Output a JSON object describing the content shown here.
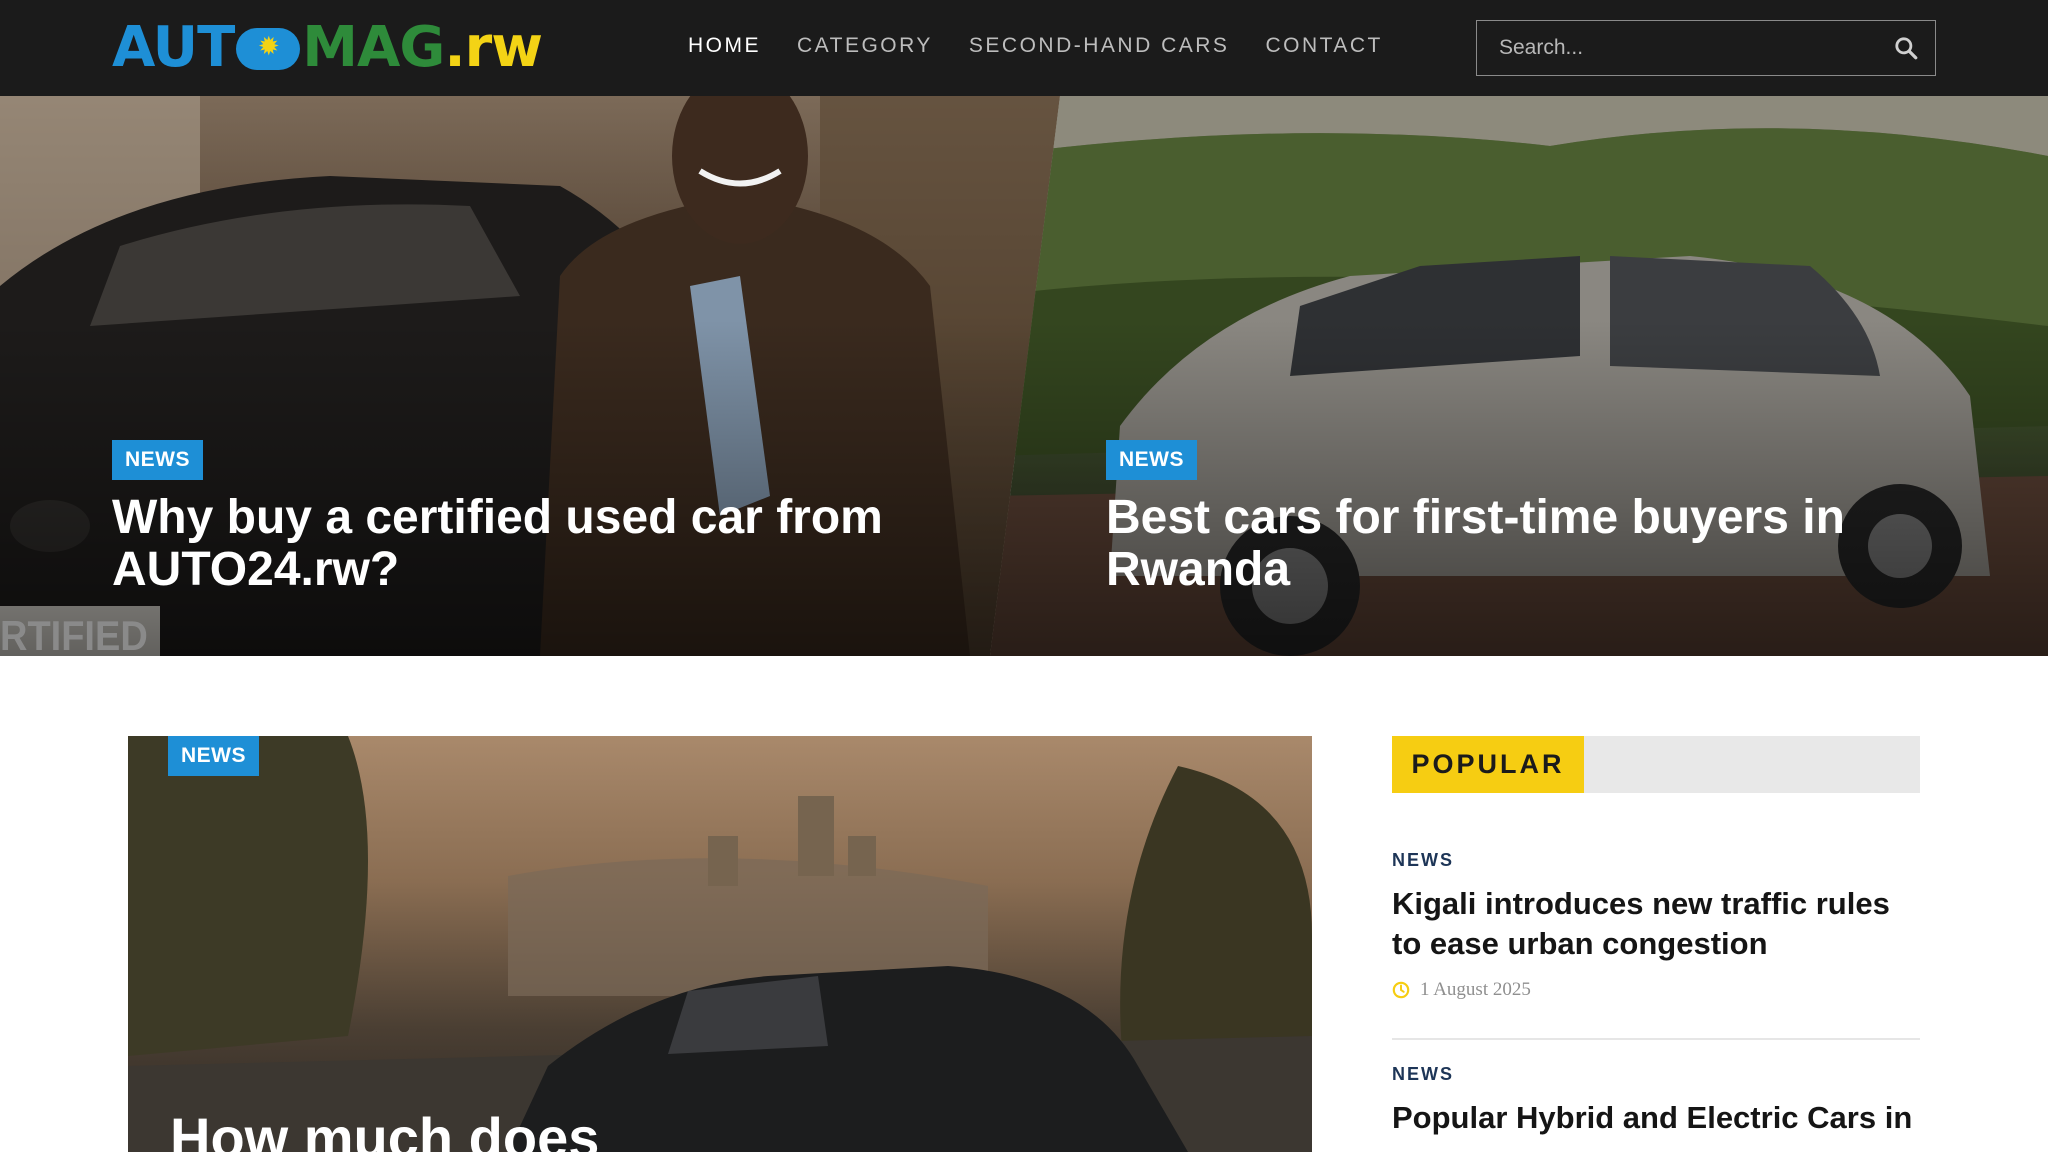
{
  "navbar": {
    "logo": {
      "part1": "AUT",
      "part2": "MAG",
      "part3": ".rw"
    },
    "menu": [
      {
        "label": "HOME",
        "active": true
      },
      {
        "label": "CATEGORY",
        "active": false
      },
      {
        "label": "SECOND-HAND CARS",
        "active": false
      },
      {
        "label": "CONTACT",
        "active": false
      }
    ],
    "search": {
      "placeholder": "Search...",
      "value": ""
    }
  },
  "hero": {
    "slides": [
      {
        "category": "NEWS",
        "title": "Why buy a certified used car from AUTO24.rw?",
        "plate_text": "RTIFIED"
      },
      {
        "category": "NEWS",
        "title": "Best cars for first-time buyers in Rwanda"
      }
    ]
  },
  "feature": {
    "category": "NEWS",
    "title": "How much does"
  },
  "sidebar": {
    "heading": "POPULAR",
    "items": [
      {
        "category": "NEWS",
        "title": "Kigali introduces new traffic rules to ease urban congestion",
        "date": "1 August 2025"
      },
      {
        "category": "NEWS",
        "title": "Popular Hybrid and Electric Cars in"
      }
    ]
  },
  "colors": {
    "accent_blue": "#1e8fd6",
    "accent_yellow": "#f6cd12",
    "logo_green": "#2e8b3a",
    "nav_bg": "#1b1b1b"
  },
  "icons": [
    "search-icon",
    "clock-icon",
    "sun-icon"
  ]
}
